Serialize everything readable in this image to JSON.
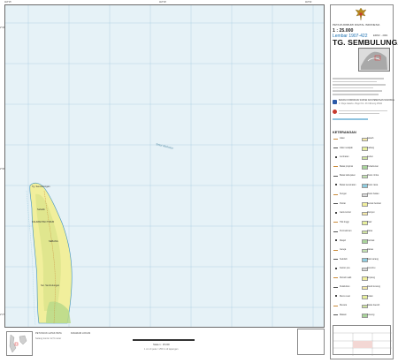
{
  "header": {
    "series": "PETA RUPABUMI DIGITAL INDONESIA",
    "scale": "1 : 25.000",
    "sheet_number": "Lembar 1907-422",
    "edition": "EDISI I - 2001",
    "title": "TG. SEMBULUNGAN"
  },
  "map": {
    "sea_label": "Selat Makasar",
    "island_labels": {
      "tg": "Tg. Sembulungan",
      "area": "KALIMANTAN TIMUR",
      "kelurahan": "SEBANG",
      "village": "Sebatik",
      "river": "Sei. Sembulungan"
    },
    "colors": {
      "sea": "#e6f2f7",
      "land": "#f1ef9c",
      "forest": "#d9e38a",
      "mangrove": "#c7dc8d",
      "grid": "#9ec9dd",
      "coast": "#3a8fbf"
    },
    "ticks_top": [
      "118°15'",
      "118°18'",
      "118°21'"
    ],
    "ticks_left": [
      "2°33'",
      "2°30'",
      "2°27'"
    ]
  },
  "legend": {
    "heading": "KETERANGAN",
    "agency": "BADAN KOORDINASI SURVEI DAN PEMETAAN NASIONAL",
    "agency_address": "Jl. Raya Jakarta - Bogor Km. 46 Cibinong 16911",
    "items_left": [
      "Jalan",
      "Jalan setapak",
      "Jembatan",
      "Batas propinsi",
      "Batas kabupaten",
      "Batas kecamatan",
      "Sungai",
      "Pantai",
      "Garis kontur",
      "Titik tinggi",
      "Permukiman",
      "Masjid",
      "Gereja",
      "Sekolah",
      "Kantor pos",
      "Rumah sakit",
      "Pelabuhan",
      "Mercu suar",
      "Menara",
      "Makam"
    ],
    "items_right": [
      "Sawah",
      "Ladang",
      "Kebun",
      "Perkebunan",
      "Hutan rimba",
      "Hutan rawa",
      "Hutan bakau",
      "Semak belukar",
      "Rumput",
      "Pasir",
      "Rawa",
      "Tambak",
      "Danau",
      "Batu karang",
      "Terumbu",
      "Empang",
      "Tanah kosong",
      "Kolam",
      "Batas daerah",
      "Gosong"
    ],
    "swatch_colors": [
      "#f5e9a8",
      "#e7ef9c",
      "#cfe3a0",
      "#a9d49a",
      "#c4e2b1",
      "#8fcde0",
      "#dadada",
      "#f1ef9c"
    ]
  },
  "footer": {
    "scale_note": "Skala 1 : 25.000",
    "contour_note": "Selang kontur 12,5 meter",
    "bottom_left": "PETUNJUK LETAK PETA",
    "bottom_mid": "1 cm di peta = 250 m di lapangan",
    "index_title": "DIAGRAM LOKASI"
  }
}
